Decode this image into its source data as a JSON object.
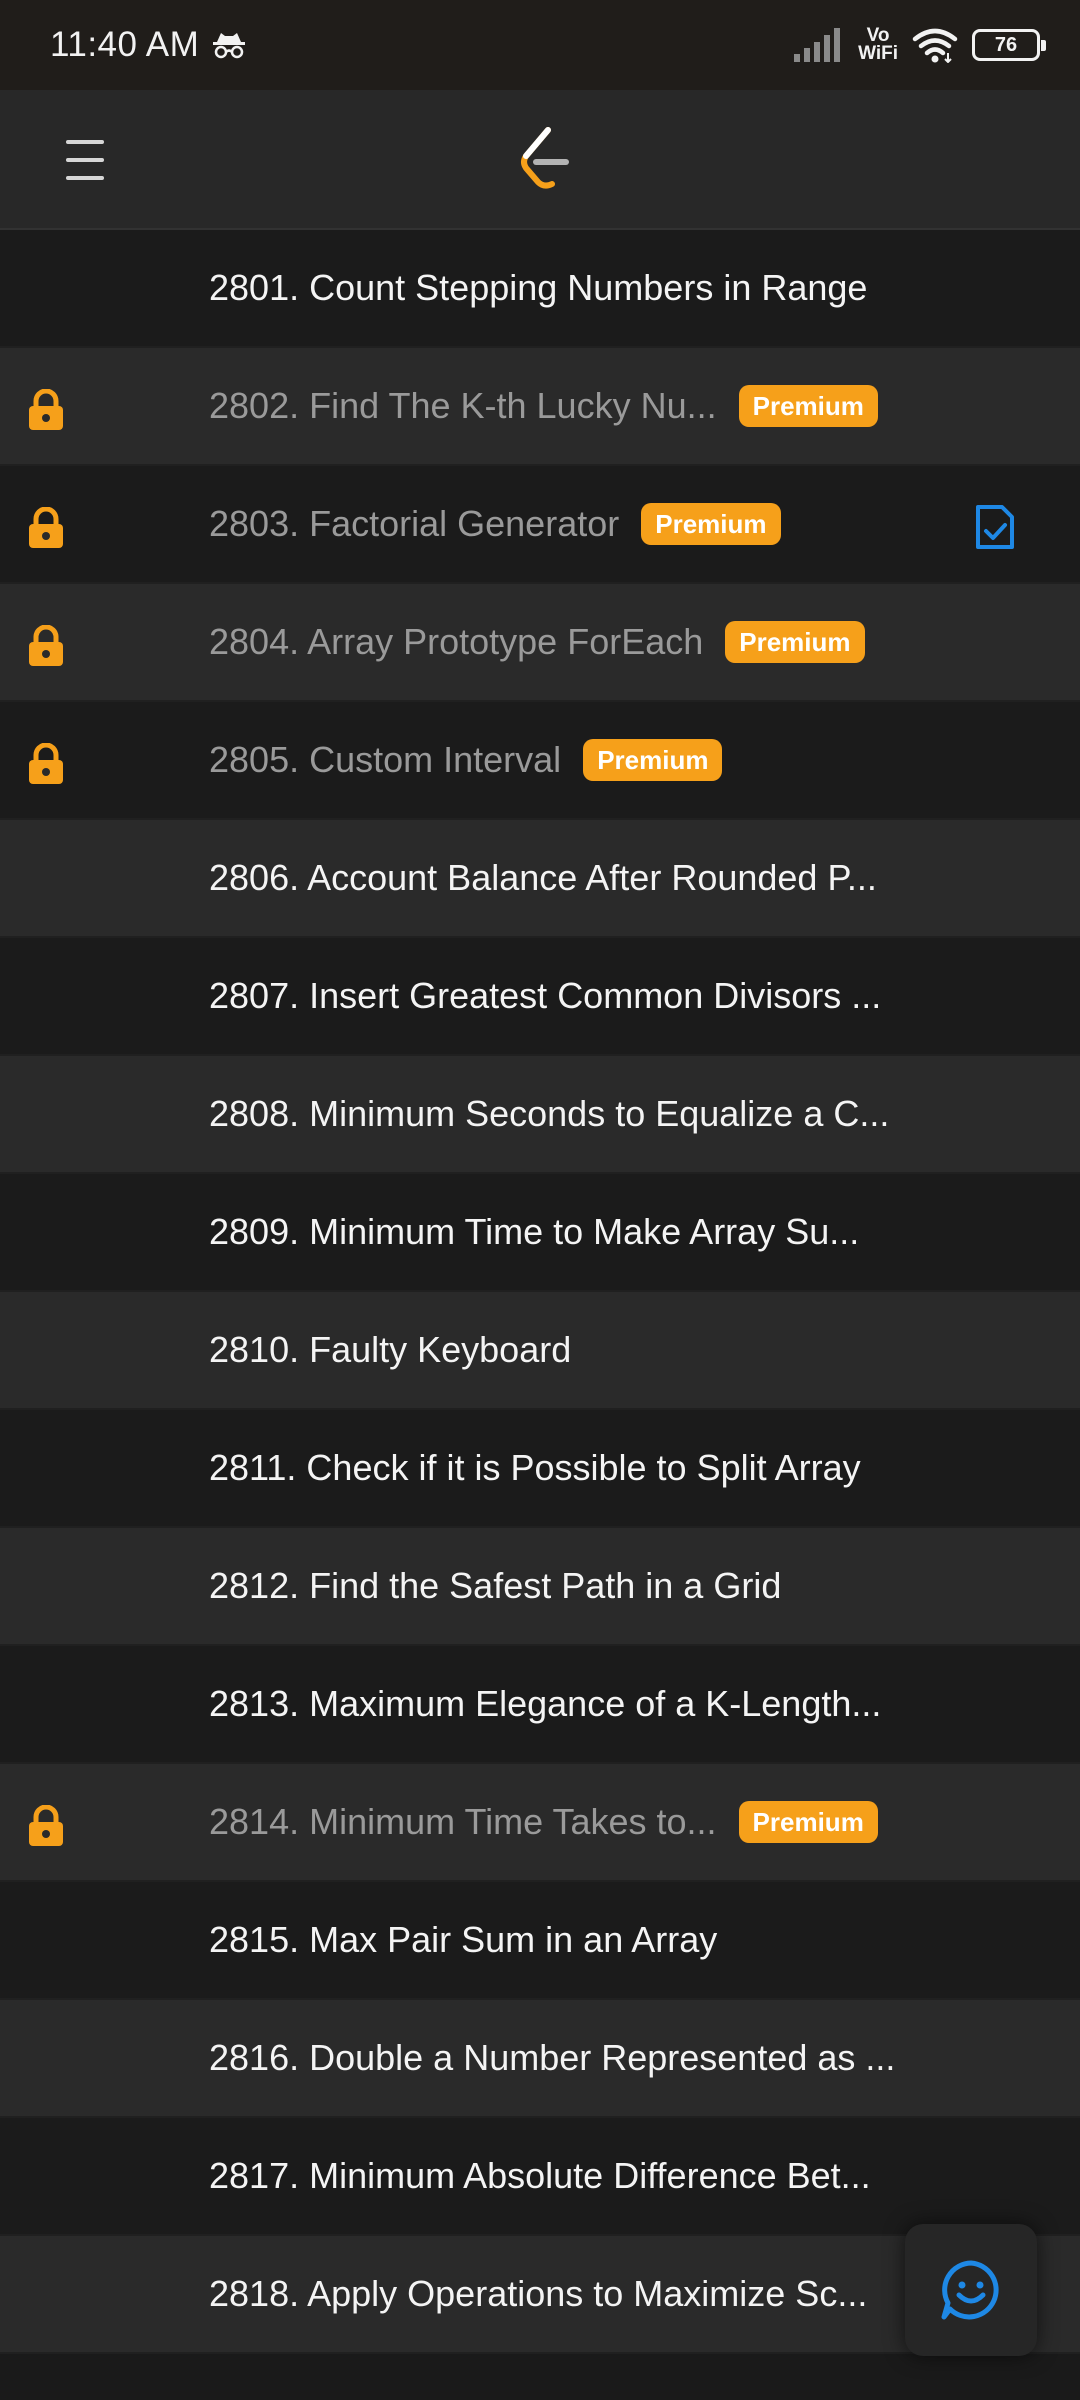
{
  "status": {
    "time": "11:40 AM",
    "vowifi_top": "Vo",
    "vowifi_bottom": "WiFi",
    "battery": "76"
  },
  "problems": [
    {
      "label": "2801. Count Stepping Numbers in Range",
      "locked": false
    },
    {
      "label": "2802. Find The K-th Lucky Nu...",
      "locked": true,
      "badge": "Premium"
    },
    {
      "label": "2803. Factorial Generator",
      "locked": true,
      "badge": "Premium",
      "solution": true
    },
    {
      "label": "2804. Array Prototype ForEach",
      "locked": true,
      "badge": "Premium"
    },
    {
      "label": "2805. Custom Interval",
      "locked": true,
      "badge": "Premium"
    },
    {
      "label": "2806. Account Balance After Rounded P...",
      "locked": false
    },
    {
      "label": "2807. Insert Greatest Common Divisors ...",
      "locked": false
    },
    {
      "label": "2808. Minimum Seconds to Equalize a C...",
      "locked": false
    },
    {
      "label": "2809. Minimum Time to Make Array Su...",
      "locked": false
    },
    {
      "label": "2810. Faulty Keyboard",
      "locked": false
    },
    {
      "label": "2811. Check if it is Possible to Split Array",
      "locked": false
    },
    {
      "label": "2812. Find the Safest Path in a Grid",
      "locked": false
    },
    {
      "label": "2813. Maximum Elegance of a K-Length...",
      "locked": false
    },
    {
      "label": "2814. Minimum Time Takes to...",
      "locked": true,
      "badge": "Premium"
    },
    {
      "label": "2815. Max Pair Sum in an Array",
      "locked": false
    },
    {
      "label": "2816. Double a Number Represented as ...",
      "locked": false
    },
    {
      "label": "2817. Minimum Absolute Difference Bet...",
      "locked": false
    },
    {
      "label": "2818. Apply Operations to Maximize Sc...",
      "locked": false
    }
  ],
  "colors": {
    "accent": "#f6a01a",
    "solution": "#1e88e5",
    "row_dark": "#1b1b1b",
    "row_light": "#2a2a2a"
  }
}
